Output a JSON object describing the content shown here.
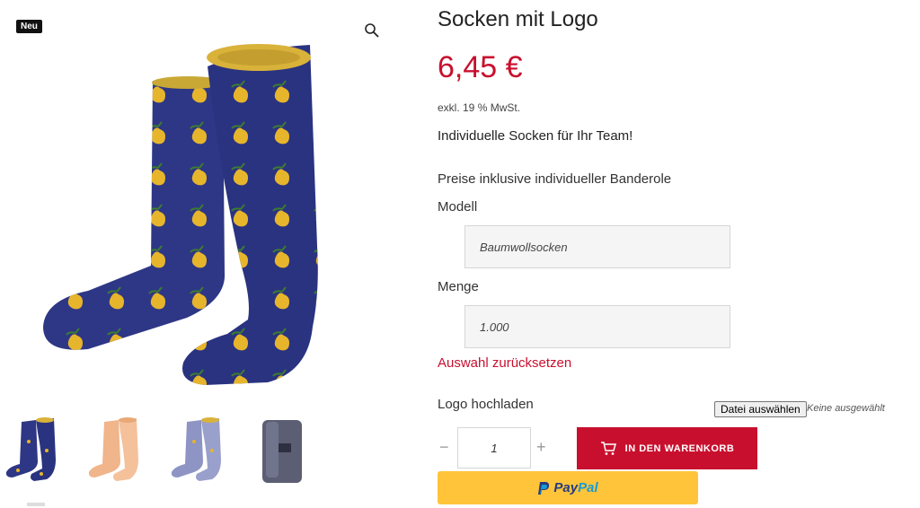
{
  "gallery": {
    "badge": "Neu",
    "zoom_icon": "magnifier-icon",
    "thumbnails": [
      "navy-pear-socks",
      "peach-socks",
      "grey-blue-socks",
      "sock-packaging"
    ]
  },
  "product": {
    "title": "Socken mit Logo",
    "price": "6,45 €",
    "tax_note": "exkl. 19 % MwSt.",
    "short_description": "Individuelle Socken für Ihr Team!",
    "price_note": "Preise inklusive individueller Banderole"
  },
  "variations": {
    "model_label": "Modell",
    "model_value": "Baumwollsocken",
    "quantity_label": "Menge",
    "quantity_value": "1.000",
    "reset_label": "Auswahl zurücksetzen"
  },
  "upload": {
    "label": "Logo hochladen",
    "button": "Datei auswählen",
    "status": "Keine ausgewählt"
  },
  "cart": {
    "minus": "−",
    "qty": "1",
    "plus": "+",
    "add_label": "IN DEN WARENKORB"
  },
  "paypal": {
    "brand_a": "Pay",
    "brand_b": "Pal"
  },
  "colors": {
    "accent": "#c8102e",
    "paypal_yellow": "#ffc439",
    "sock_navy": "#2e3785",
    "pear_yellow": "#e6b52c"
  }
}
